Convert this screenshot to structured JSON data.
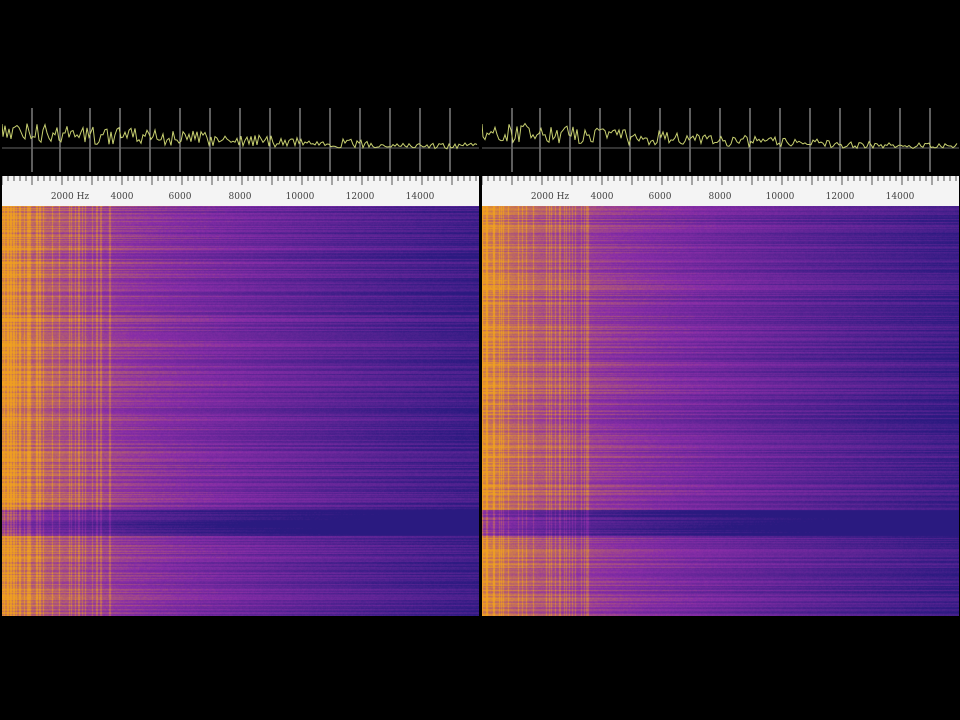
{
  "panels": [
    {
      "id": "left",
      "ruler_labels": [
        "2000 Hz",
        "4000",
        "6000",
        "8000",
        "10000",
        "12000",
        "14000"
      ]
    },
    {
      "id": "right",
      "ruler_labels": [
        "2000 Hz",
        "4000",
        "6000",
        "8000",
        "10000",
        "12000",
        "14000"
      ]
    }
  ],
  "colors": {
    "background": "#000000",
    "trace": "#c8d070",
    "ruler_bg": "#f4f4f4",
    "waterfall_hot": "#f0a020",
    "waterfall_mid": "#8a2ea8",
    "waterfall_cold": "#2a1a80"
  }
}
